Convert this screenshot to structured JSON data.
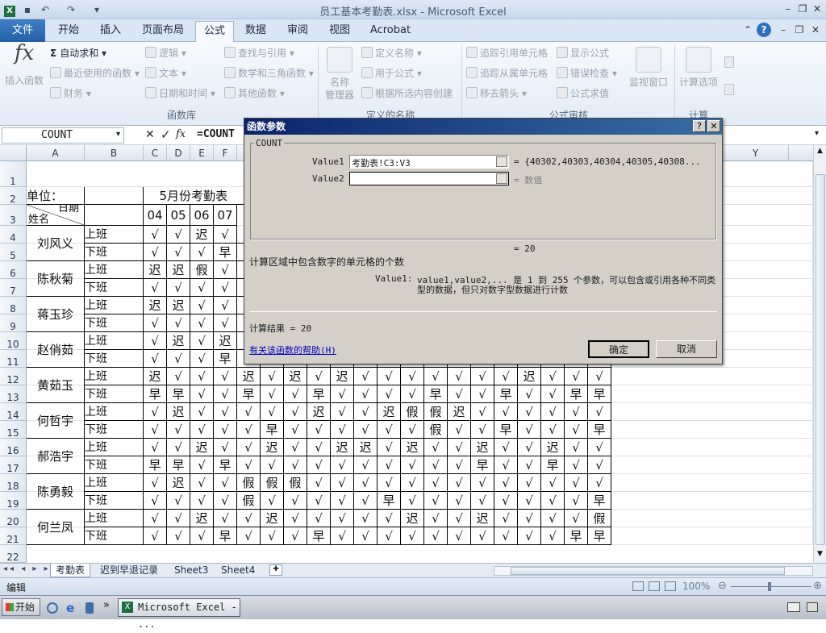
{
  "window": {
    "title": "员工基本考勤表.xlsx - Microsoft Excel",
    "min": "–",
    "restore": "❐",
    "close": "✕"
  },
  "ribbon_tabs": [
    "文件",
    "开始",
    "插入",
    "页面布局",
    "公式",
    "数据",
    "审阅",
    "视图",
    "Acrobat"
  ],
  "ribbon": {
    "insert_function": "插入函数",
    "autosum": "自动求和",
    "recent": "最近使用的函数",
    "financial": "财务",
    "logical": "逻辑",
    "text": "文本",
    "datetime": "日期和时间",
    "lookup": "查找与引用",
    "math": "数学和三角函数",
    "other": "其他函数",
    "group_library": "函数库",
    "name_manager_1": "名称",
    "name_manager_2": "管理器",
    "define_name": "定义名称",
    "use_in_formula": "用于公式",
    "create_from_sel": "根据所选内容创建",
    "group_names": "定义的名称",
    "trace_prec": "追踪引用单元格",
    "trace_dep": "追踪从属单元格",
    "remove_arrows": "移去箭头",
    "show_formulas": "显示公式",
    "error_check": "错误检查",
    "eval_formula": "公式求值",
    "group_audit": "公式审核",
    "watch": "监视窗口",
    "calc_options": "计算选项",
    "group_calc": "计算"
  },
  "formula_bar": {
    "name_box": "COUNT",
    "fx": "fx",
    "content": "=COUNT"
  },
  "sheet": {
    "col_headers": [
      "A",
      "B",
      "C",
      "D",
      "E",
      "F",
      "Y"
    ],
    "row_headers": [
      "1",
      "2",
      "3",
      "4",
      "5",
      "6",
      "7",
      "8",
      "9",
      "10",
      "11",
      "12",
      "13",
      "14",
      "15",
      "16",
      "17",
      "18",
      "19",
      "20",
      "21",
      "22"
    ],
    "unit_label": "单位：",
    "month_num": "5",
    "month_title": "月份考勤表",
    "diag_top": "日期",
    "diag_bottom": "姓名",
    "days": [
      "04",
      "05",
      "06",
      "07"
    ],
    "on_label": "上班",
    "off_label": "下班",
    "names": [
      "刘风义",
      "陈秋菊",
      "蒋玉珍",
      "赵俏茹",
      "黄茹玉",
      "何哲宇",
      "郝浩宇",
      "陈勇毅",
      "何兰凤"
    ],
    "grid": [
      [
        "√",
        "√",
        "迟",
        "√",
        ""
      ],
      [
        "√",
        "√",
        "√",
        "早",
        ""
      ],
      [
        "迟",
        "迟",
        "假",
        "√",
        ""
      ],
      [
        "√",
        "√",
        "√",
        "√",
        ""
      ],
      [
        "迟",
        "迟",
        "√",
        "√",
        ""
      ],
      [
        "√",
        "√",
        "√",
        "√",
        ""
      ],
      [
        "√",
        "迟",
        "√",
        "迟",
        ""
      ],
      [
        "√",
        "√",
        "√",
        "早",
        "√",
        "√",
        "早",
        "√",
        "√",
        "√",
        "√",
        "早",
        "√",
        "早",
        "√",
        "早",
        "√",
        "√",
        "早",
        "√"
      ],
      [
        "迟",
        "√",
        "√",
        "√",
        "迟",
        "√",
        "迟",
        "√",
        "迟",
        "√",
        "√",
        "√",
        "√",
        "√",
        "√",
        "√",
        "迟",
        "√",
        "√",
        "√"
      ],
      [
        "早",
        "早",
        "√",
        "√",
        "早",
        "√",
        "√",
        "早",
        "√",
        "√",
        "√",
        "√",
        "早",
        "√",
        "√",
        "早",
        "√",
        "√",
        "早",
        "早"
      ],
      [
        "√",
        "迟",
        "√",
        "√",
        "√",
        "√",
        "√",
        "迟",
        "√",
        "√",
        "迟",
        "假",
        "假",
        "迟",
        "√",
        "√",
        "√",
        "√",
        "√",
        "√"
      ],
      [
        "√",
        "√",
        "√",
        "√",
        "√",
        "早",
        "√",
        "√",
        "√",
        "√",
        "√",
        "√",
        "假",
        "√",
        "√",
        "早",
        "√",
        "√",
        "√",
        "早"
      ],
      [
        "√",
        "√",
        "迟",
        "√",
        "√",
        "迟",
        "√",
        "√",
        "迟",
        "迟",
        "√",
        "迟",
        "√",
        "√",
        "迟",
        "√",
        "√",
        "迟",
        "√",
        "√"
      ],
      [
        "早",
        "早",
        "√",
        "早",
        "√",
        "√",
        "√",
        "√",
        "√",
        "√",
        "√",
        "√",
        "√",
        "√",
        "早",
        "√",
        "√",
        "早",
        "√",
        "√"
      ],
      [
        "√",
        "迟",
        "√",
        "√",
        "假",
        "假",
        "假",
        "√",
        "√",
        "√",
        "√",
        "√",
        "√",
        "√",
        "√",
        "√",
        "√",
        "√",
        "√",
        "√"
      ],
      [
        "√",
        "√",
        "√",
        "√",
        "假",
        "√",
        "√",
        "√",
        "√",
        "√",
        "早",
        "√",
        "√",
        "√",
        "√",
        "√",
        "√",
        "√",
        "√",
        "早"
      ],
      [
        "√",
        "√",
        "迟",
        "√",
        "√",
        "迟",
        "√",
        "√",
        "√",
        "√",
        "√",
        "迟",
        "√",
        "√",
        "迟",
        "√",
        "√",
        "√",
        "√",
        "假"
      ],
      [
        "√",
        "√",
        "√",
        "早",
        "√",
        "√",
        "√",
        "早",
        "√",
        "√",
        "√",
        "√",
        "√",
        "√",
        "√",
        "√",
        "√",
        "√",
        "早",
        "早"
      ]
    ]
  },
  "sheet_tabs": [
    "考勤表",
    "迟到早退记录",
    "Sheet3",
    "Sheet4"
  ],
  "status": {
    "mode": "编辑",
    "zoom": "100%"
  },
  "taskbar": {
    "start": "开始",
    "excel_task": "Microsoft Excel - ..."
  },
  "dialog": {
    "title": "函数参数",
    "help_btn": "?",
    "close_btn": "✕",
    "func_name": "COUNT",
    "value1_label": "Value1",
    "value1_input": "考勤表!C3:V3",
    "value1_result": "= {40302,40303,40304,40305,40308...",
    "value2_label": "Value2",
    "value2_input": "",
    "value2_result": "= 数值",
    "total_result": "= 20",
    "description": "计算区域中包含数字的单元格的个数",
    "arg_label": "Value1:",
    "arg_desc_1": "value1,value2,... 是 1 到 255 个参数，可以包含或引用各种不同类",
    "arg_desc_2": "型的数据，但只对数字型数据进行计数",
    "calc_result": "计算结果 = 20",
    "help_link": "有关该函数的帮助(H)",
    "ok": "确定",
    "cancel": "取消"
  }
}
